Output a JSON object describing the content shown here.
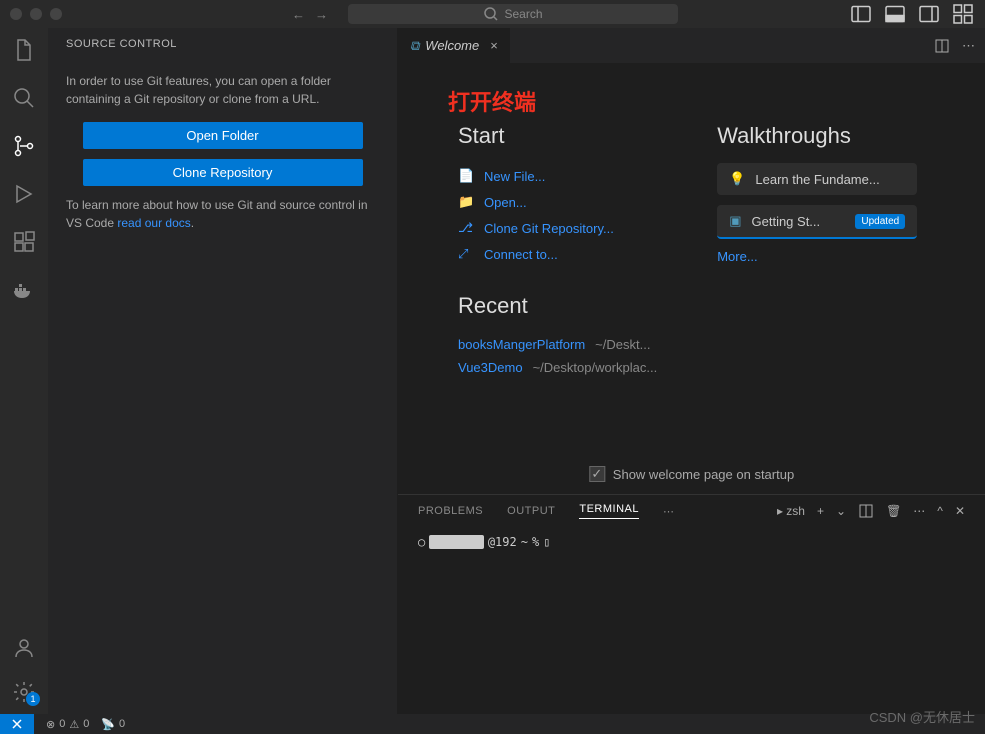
{
  "titlebar": {
    "search_placeholder": "Search"
  },
  "sidebar": {
    "title": "SOURCE CONTROL",
    "intro": "In order to use Git features, you can open a folder containing a Git repository or clone from a URL.",
    "open_folder": "Open Folder",
    "clone_repo": "Clone Repository",
    "learn_more": "To learn more about how to use Git and source control in VS Code ",
    "docs_link": "read our docs",
    "period": "."
  },
  "tab": {
    "title": "Welcome",
    "close": "×"
  },
  "annotation": "打开终端",
  "welcome": {
    "start": {
      "heading": "Start",
      "items": [
        {
          "label": "New File...",
          "icon": "file"
        },
        {
          "label": "Open...",
          "icon": "folder"
        },
        {
          "label": "Clone Git Repository...",
          "icon": "git"
        },
        {
          "label": "Connect to...",
          "icon": "connect"
        }
      ]
    },
    "recent": {
      "heading": "Recent",
      "items": [
        {
          "name": "booksMangerPlatform",
          "path": "~/Deskt..."
        },
        {
          "name": "Vue3Demo",
          "path": "~/Desktop/workplac..."
        }
      ]
    },
    "walkthroughs": {
      "heading": "Walkthroughs",
      "items": [
        {
          "label": "Learn the Fundame..."
        },
        {
          "label": "Getting St...",
          "badge": "Updated"
        }
      ],
      "more": "More..."
    },
    "show_on_startup": "Show welcome page on startup"
  },
  "panel": {
    "tabs": {
      "problems": "PROBLEMS",
      "output": "OUTPUT",
      "terminal": "TERMINAL"
    },
    "shell": "zsh",
    "prompt_user": "@192",
    "prompt_path": "~",
    "prompt_symbol": "%"
  },
  "statusbar": {
    "errors": "0",
    "warnings": "0",
    "ports": "0",
    "gear_badge": "1"
  },
  "watermark": "CSDN @无休居士"
}
